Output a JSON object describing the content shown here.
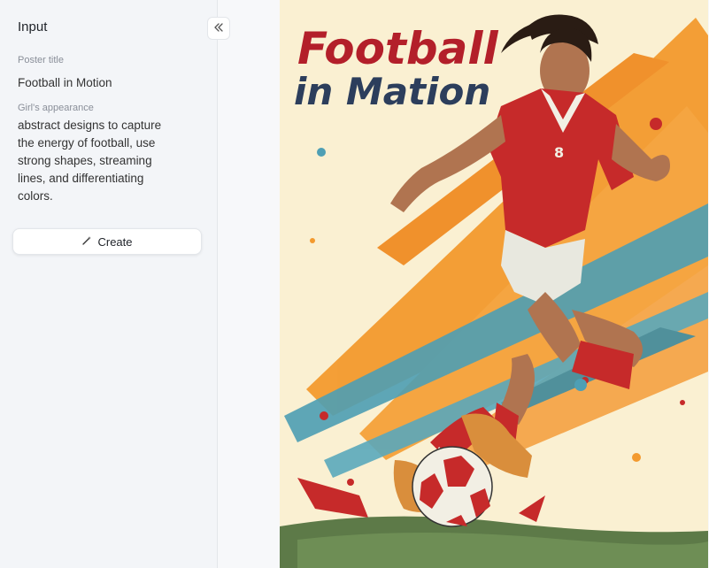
{
  "sidebar": {
    "title": "Input",
    "collapse_icon": "double-chevron-left-icon",
    "fields": {
      "poster_title_label": "Poster title",
      "poster_title_value": "Football in Motion",
      "appearance_label": "Girl's appearance",
      "appearance_value": "abstract designs to capture\nthe energy of football, use\nstrong shapes, streaming\nlines, and differentiating\ncolors."
    },
    "create_button": {
      "label": "Create",
      "icon": "magic-wand-icon"
    }
  },
  "poster": {
    "title_line1": "Football",
    "title_line2": "in Mation",
    "colors": {
      "background": "#faf0d2",
      "title_red": "#b31f2a",
      "title_navy": "#2c3e5c",
      "orange": "#f39a2e",
      "teal": "#4e9fb4",
      "jersey_red": "#c62a2a",
      "grass": "#5d7a48"
    }
  }
}
